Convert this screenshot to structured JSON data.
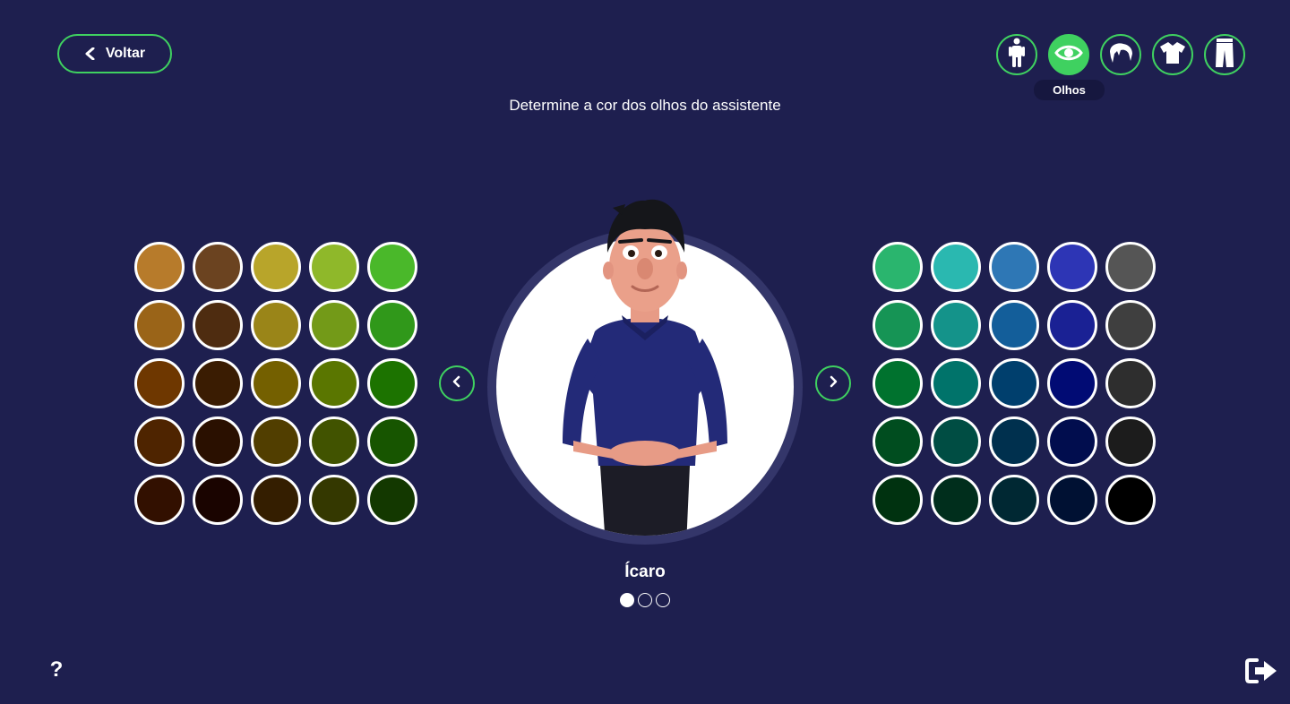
{
  "header": {
    "back_label": "Voltar",
    "instruction": "Determine a cor dos olhos do assistente"
  },
  "categories": [
    {
      "icon": "body-icon",
      "active": false
    },
    {
      "icon": "eye-icon",
      "active": true,
      "label": "Olhos"
    },
    {
      "icon": "hair-icon",
      "active": false
    },
    {
      "icon": "shirt-icon",
      "active": false
    },
    {
      "icon": "pants-icon",
      "active": false
    }
  ],
  "active_category_label": "Olhos",
  "left_palette": [
    "#b77b2b",
    "#6b4320",
    "#b8a52a",
    "#8fb82a",
    "#4ab82a",
    "#9a6418",
    "#4e2c10",
    "#9a8518",
    "#739a18",
    "#30981a",
    "#6e3700",
    "#3a1c02",
    "#746000",
    "#5a7600",
    "#1c7300",
    "#4e2400",
    "#2a1000",
    "#513e00",
    "#415300",
    "#175500",
    "#321000",
    "#1a0400",
    "#341e00",
    "#343800",
    "#133800"
  ],
  "right_palette": [
    "#2ab56e",
    "#2ab8b0",
    "#2e77b5",
    "#2d35b5",
    "#555555",
    "#169455",
    "#14938a",
    "#135e9a",
    "#1a2194",
    "#3f3f3f",
    "#00722e",
    "#00736a",
    "#003f6d",
    "#010b74",
    "#2e2e2e",
    "#004d1f",
    "#004d43",
    "#00304e",
    "#010d4e",
    "#1c1c1c",
    "#003210",
    "#002e1c",
    "#002833",
    "#001133",
    "#000000"
  ],
  "avatar": {
    "name": "Ícaro",
    "page_count": 3,
    "current_page": 1
  },
  "footer": {
    "help_label": "?"
  },
  "colors": {
    "background": "#1e1f4f",
    "accent": "#3fd160",
    "ring": "#34366a"
  }
}
